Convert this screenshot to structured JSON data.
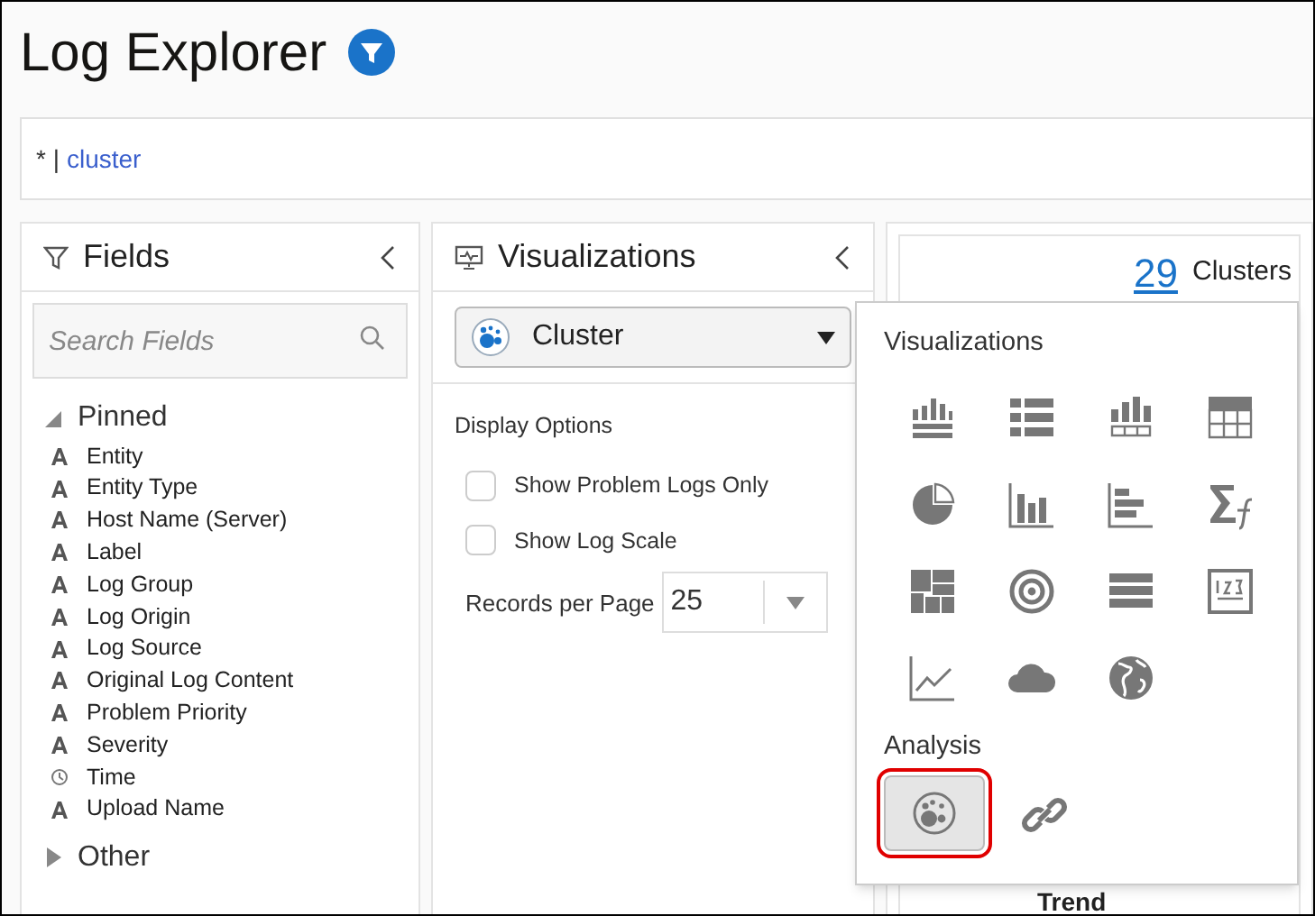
{
  "title": "Log Explorer",
  "query": {
    "prefix": "* |",
    "command": "cluster"
  },
  "fields_panel": {
    "title": "Fields",
    "search": {
      "placeholder": "Search Fields"
    },
    "groups": [
      {
        "label": "Pinned",
        "expanded": true,
        "children": [
          {
            "label": "Entity",
            "kind": "text"
          },
          {
            "label": "Entity Type",
            "kind": "text"
          },
          {
            "label": "Host Name (Server)",
            "kind": "text"
          },
          {
            "label": "Label",
            "kind": "text"
          },
          {
            "label": "Log Group",
            "kind": "text"
          },
          {
            "label": "Log Origin",
            "kind": "text"
          },
          {
            "label": "Log Source",
            "kind": "text"
          },
          {
            "label": "Original Log Content",
            "kind": "text"
          },
          {
            "label": "Problem Priority",
            "kind": "text"
          },
          {
            "label": "Severity",
            "kind": "text"
          },
          {
            "label": "Time",
            "kind": "time"
          },
          {
            "label": "Upload Name",
            "kind": "text"
          }
        ]
      },
      {
        "label": "Other",
        "expanded": false
      }
    ]
  },
  "visualizations_panel": {
    "title": "Visualizations",
    "type": "Cluster",
    "display_options": "Display Options",
    "options": [
      {
        "label": "Show Problem Logs Only",
        "checked": false
      },
      {
        "label": "Show Log Scale",
        "checked": false
      }
    ],
    "records_per_page": {
      "label": "Records per Page",
      "value": "25"
    }
  },
  "results": {
    "count": "29",
    "label": "Clusters",
    "column": "Trend"
  },
  "popup": {
    "sections": [
      {
        "heading": "Visualizations",
        "items": [
          {
            "kind": "histogram-table",
            "selected": false
          },
          {
            "kind": "table",
            "selected": false
          },
          {
            "kind": "bar-table",
            "selected": false
          },
          {
            "kind": "grid",
            "selected": false
          },
          {
            "kind": "pie",
            "selected": false
          },
          {
            "kind": "bar",
            "selected": false
          },
          {
            "kind": "hbar",
            "selected": false
          },
          {
            "kind": "summary",
            "selected": false
          },
          {
            "kind": "treemap",
            "selected": false
          },
          {
            "kind": "target",
            "selected": false
          },
          {
            "kind": "records",
            "selected": false
          },
          {
            "kind": "tile",
            "selected": false
          },
          {
            "kind": "line",
            "selected": false
          },
          {
            "kind": "cloud",
            "selected": false
          },
          {
            "kind": "globe",
            "selected": false
          }
        ]
      },
      {
        "heading": "Analysis",
        "items": [
          {
            "kind": "cluster",
            "selected": true
          },
          {
            "kind": "link",
            "selected": false
          }
        ]
      }
    ]
  }
}
